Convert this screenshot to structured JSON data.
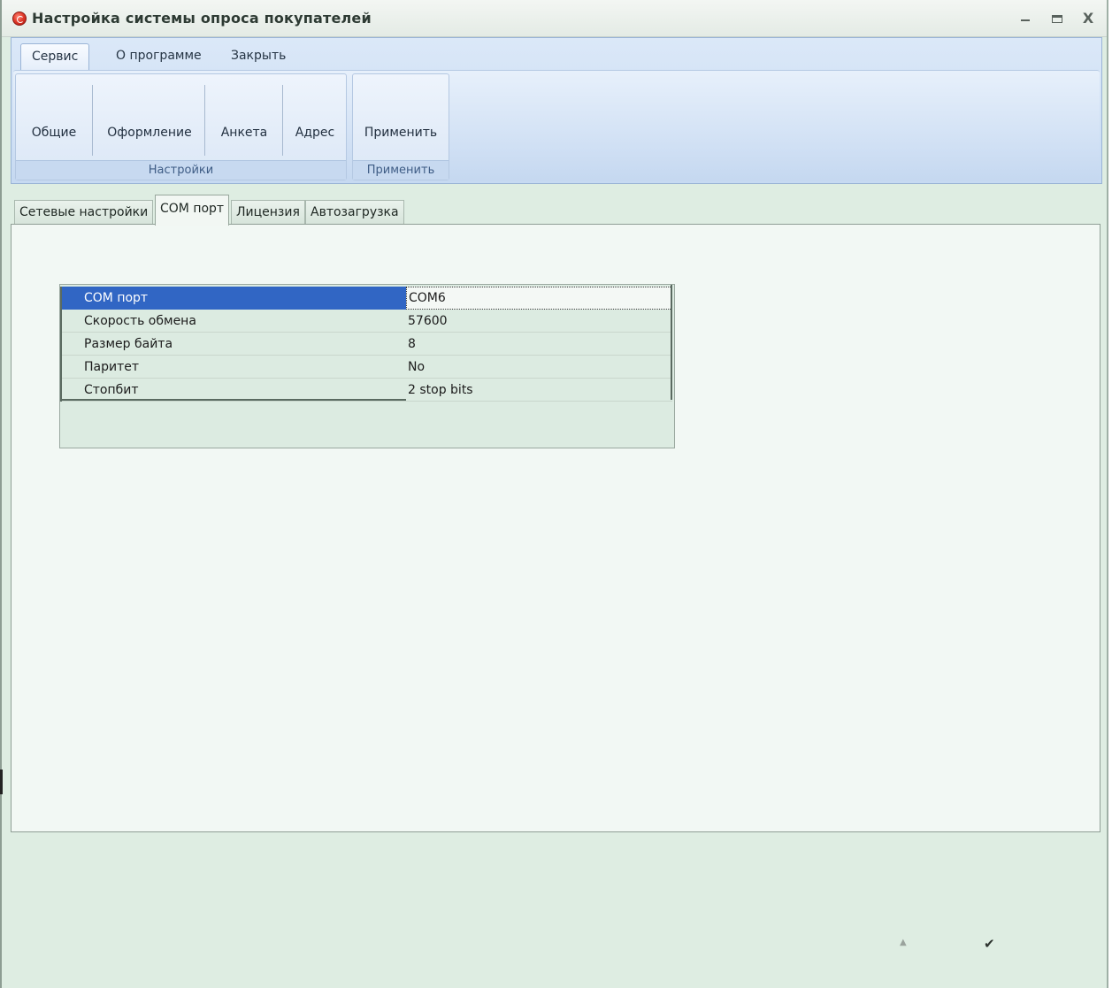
{
  "window": {
    "title": "Настройка системы опроса покупателей",
    "controls": {
      "minimize": "–",
      "maximize": "□",
      "close": "X"
    }
  },
  "ribbon": {
    "tabs": [
      {
        "label": "Сервис",
        "active": true
      },
      {
        "label": "О программе",
        "active": false
      },
      {
        "label": "Закрыть",
        "active": false
      }
    ],
    "groups": [
      {
        "caption": "Настройки",
        "buttons": [
          "Общие",
          "Оформление",
          "Анкета",
          "Адрес"
        ]
      },
      {
        "caption": "Применить",
        "buttons": [
          "Применить"
        ]
      }
    ]
  },
  "tabs": [
    {
      "label": "Сетевые настройки",
      "active": false
    },
    {
      "label": "COM порт",
      "active": true
    },
    {
      "label": "Лицензия",
      "active": false
    },
    {
      "label": "Автозагрузка",
      "active": false
    }
  ],
  "property_grid": {
    "rows": [
      {
        "name": "COM порт",
        "value": "COM6",
        "selected": true
      },
      {
        "name": "Скорость обмена",
        "value": "57600",
        "selected": false
      },
      {
        "name": "Размер байта",
        "value": "8",
        "selected": false
      },
      {
        "name": "Паритет",
        "value": "No",
        "selected": false
      },
      {
        "name": "Стопбит",
        "value": "2 stop bits",
        "selected": false
      }
    ]
  },
  "footer": {
    "up_icon": "triangle-up-icon",
    "ok_icon": "checkmark-icon"
  },
  "colors": {
    "selection": "#3166c4",
    "ribbon": "#c6daf2",
    "background": "#deede2"
  }
}
